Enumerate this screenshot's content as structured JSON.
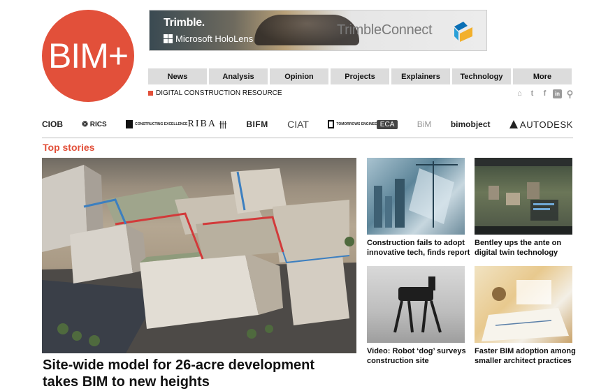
{
  "logo": {
    "text": "BIM+"
  },
  "ad": {
    "brand": "Trimble.",
    "partner": "Microsoft HoloLens",
    "product": "TrimbleConnect"
  },
  "nav": {
    "items": [
      {
        "label": "News"
      },
      {
        "label": "Analysis"
      },
      {
        "label": "Opinion"
      },
      {
        "label": "Projects"
      },
      {
        "label": "Explainers"
      },
      {
        "label": "Technology"
      },
      {
        "label": "More"
      }
    ]
  },
  "tagline": "DIGITAL CONSTRUCTION RESOURCE",
  "social": [
    {
      "icon": "home-icon",
      "glyph": "⌂"
    },
    {
      "icon": "twitter-icon",
      "glyph": "t"
    },
    {
      "icon": "facebook-icon",
      "glyph": "f"
    },
    {
      "icon": "linkedin-icon",
      "glyph": "in"
    },
    {
      "icon": "search-icon",
      "glyph": "⚲"
    }
  ],
  "partners": [
    {
      "label": "CIOB"
    },
    {
      "label": "RICS"
    },
    {
      "label": "CONSTRUCTING EXCELLENCE"
    },
    {
      "label": "RIBA"
    },
    {
      "label": "BIFM"
    },
    {
      "label": "CIAT"
    },
    {
      "label": "TOMORROWS ENGINEERS"
    },
    {
      "label": "ECA"
    },
    {
      "label": "BiM"
    },
    {
      "label": "bimobject"
    },
    {
      "label": "AUTODESK"
    }
  ],
  "section": {
    "title": "Top stories"
  },
  "hero": {
    "title": "Site-wide model for 26-acre development takes BIM to new heights"
  },
  "cards": [
    {
      "title": "Construction fails to adopt innovative tech, finds report"
    },
    {
      "title": "Bentley ups the ante on digital twin technology"
    },
    {
      "title": "Video: Robot ‘dog’ surveys construction site"
    },
    {
      "title": "Faster BIM adoption among smaller architect practices"
    }
  ],
  "colors": {
    "brand": "#e2503a",
    "nav_bg": "#dcdcdc",
    "divider": "#bdbdbd"
  }
}
